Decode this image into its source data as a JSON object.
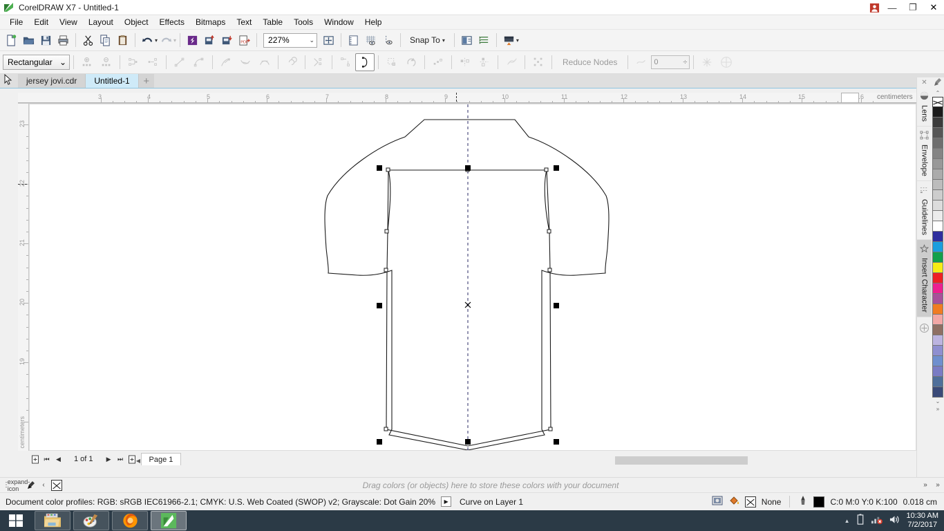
{
  "window": {
    "title": "CorelDRAW X7 - Untitled-1",
    "logo_icon": "coreldraw-logo",
    "user_icon": "user-account-icon",
    "minimize_label": "—",
    "maximize_label": "❐",
    "close_label": "✕"
  },
  "menubar": {
    "items": [
      {
        "label": "File",
        "accel": "F"
      },
      {
        "label": "Edit",
        "accel": "E"
      },
      {
        "label": "View",
        "accel": "V"
      },
      {
        "label": "Layout",
        "accel": "L"
      },
      {
        "label": "Object",
        "accel": "O"
      },
      {
        "label": "Effects",
        "accel": "c"
      },
      {
        "label": "Bitmaps",
        "accel": "B"
      },
      {
        "label": "Text",
        "accel": "x"
      },
      {
        "label": "Table",
        "accel": "T"
      },
      {
        "label": "Tools",
        "accel": "o"
      },
      {
        "label": "Window",
        "accel": "W"
      },
      {
        "label": "Help",
        "accel": "H"
      }
    ]
  },
  "standard_toolbar": {
    "buttons": [
      {
        "name": "new-document-button",
        "title": "New"
      },
      {
        "name": "open-document-button",
        "title": "Open"
      },
      {
        "name": "save-document-button",
        "title": "Save"
      },
      {
        "name": "print-button",
        "title": "Print"
      },
      {
        "name": "cut-button",
        "title": "Cut"
      },
      {
        "name": "copy-button",
        "title": "Copy"
      },
      {
        "name": "paste-button",
        "title": "Paste"
      },
      {
        "name": "undo-button",
        "title": "Undo"
      },
      {
        "name": "redo-button",
        "title": "Redo"
      },
      {
        "name": "corel-connect-button",
        "title": "Search Content"
      },
      {
        "name": "import-button",
        "title": "Import"
      },
      {
        "name": "export-button",
        "title": "Export"
      },
      {
        "name": "publish-pdf-button",
        "title": "Publish to PDF"
      }
    ],
    "zoom_level": "227%",
    "zoom_dropdown_icon": "chevron-down-icon",
    "full_screen_icon": "full-screen-preview-icon",
    "rulers_icon": "show-rulers-icon",
    "grid_icon": "show-grid-icon",
    "guidelines_icon": "show-guidelines-icon",
    "snap_to_label": "Snap To",
    "snap_to_caret": "▾",
    "options_icon": "options-icon",
    "object_manager_icon": "object-manager-icon",
    "application_launcher_icon": "application-launcher-icon"
  },
  "property_bar": {
    "selection_mode": "Rectangular",
    "selection_caret": "⌄",
    "buttons": [
      {
        "name": "add-node-button"
      },
      {
        "name": "delete-node-button"
      },
      {
        "name": "join-two-nodes-button"
      },
      {
        "name": "break-curve-button"
      },
      {
        "name": "convert-to-line-button"
      },
      {
        "name": "convert-to-curve-button"
      },
      {
        "name": "cusp-node-button"
      },
      {
        "name": "smooth-node-button"
      },
      {
        "name": "symmetrical-node-button"
      },
      {
        "name": "reverse-direction-button"
      },
      {
        "name": "extend-curve-to-close-button"
      },
      {
        "name": "extract-subpath-button"
      },
      {
        "name": "close-curve-button"
      },
      {
        "name": "stretch-nodes-button"
      },
      {
        "name": "rotate-nodes-button"
      },
      {
        "name": "align-nodes-button"
      },
      {
        "name": "reflect-nodes-horizontal-button"
      },
      {
        "name": "reflect-nodes-vertical-button"
      },
      {
        "name": "elastic-mode-button"
      },
      {
        "name": "select-all-nodes-button"
      }
    ],
    "reduce_nodes_label": "Reduce Nodes",
    "curve_smoothness_value": "0",
    "bounding-box-icon": "bounding-box-icon",
    "outline-position-icon": "outline-position-icon"
  },
  "document_tabs": {
    "tabs": [
      {
        "label": "jersey jovi.cdr",
        "active": false
      },
      {
        "label": "Untitled-1",
        "active": true
      }
    ],
    "add_label": "+"
  },
  "toolbox": {
    "tools": [
      {
        "name": "pick-tool",
        "active": false
      },
      {
        "name": "shape-tool",
        "active": false
      },
      {
        "name": "crop-tool",
        "active": false
      },
      {
        "name": "zoom-tool",
        "active": false
      },
      {
        "name": "freehand-tool",
        "active": true
      },
      {
        "name": "artistic-media-tool",
        "active": false
      },
      {
        "name": "rectangle-tool",
        "active": false
      },
      {
        "name": "ellipse-tool",
        "active": false
      },
      {
        "name": "polygon-tool",
        "active": false
      },
      {
        "name": "text-tool",
        "active": false
      },
      {
        "name": "parallel-dimension-tool",
        "active": false
      },
      {
        "name": "straight-line-connector-tool",
        "active": false
      },
      {
        "name": "drop-shadow-tool",
        "active": false
      },
      {
        "name": "transparency-tool",
        "active": false
      },
      {
        "name": "color-eyedropper-tool",
        "active": false
      },
      {
        "name": "fill-tool",
        "active": false
      },
      {
        "name": "outline-tool",
        "active": false
      },
      {
        "name": "smart-fill-tool",
        "active": false
      }
    ]
  },
  "rulers": {
    "unit_label": "centimeters",
    "horizontal_ticks": [
      "3",
      "4",
      "5",
      "6",
      "7",
      "8",
      "9",
      "10",
      "11",
      "12",
      "13",
      "14",
      "15",
      "16"
    ],
    "vertical_ticks": [
      "23",
      "22",
      "21",
      "20",
      "19"
    ]
  },
  "drawing": {
    "object_description": "jersey t-shirt outline with selected inner body curve",
    "selected_nodes": 10,
    "center_marker": "rotation-center-marker"
  },
  "page_navigator": {
    "add_page_start_icon": "add-page-icon",
    "first_label": "⏮",
    "prev_label": "◀",
    "page_count": "1 of 1",
    "next_label": "▶",
    "last_label": "⏭",
    "add_page_end_icon": "add-page-icon",
    "page_tab": "Page 1"
  },
  "dockers": {
    "close_label": "✕",
    "items": [
      {
        "label": "Lens",
        "icon": "lens-icon",
        "selected": false
      },
      {
        "label": "Envelope",
        "icon": "envelope-icon",
        "selected": false
      },
      {
        "label": "Guidelines",
        "icon": "guidelines-icon",
        "selected": false
      },
      {
        "label": "Insert Character",
        "icon": "insert-character-icon",
        "selected": true
      }
    ],
    "add_docker_icon": "add-docker-icon"
  },
  "palette": {
    "up_arrow": "⌃",
    "down_arrow": "⌄",
    "more_arrow": "»",
    "eyedropper_icon": "eyedropper-icon",
    "none_swatch": "none",
    "colors": [
      "#1c1c1c",
      "#3c3c3c",
      "#565656",
      "#6e6e6e",
      "#848484",
      "#989898",
      "#ababab",
      "#bcbcbc",
      "#cdcdcd",
      "#dcdcdc",
      "#ececec",
      "#ffffff",
      "#2e2e9e",
      "#1a9ede",
      "#12a04a",
      "#f7ec16",
      "#ee2024",
      "#ec2090",
      "#a7509a",
      "#f07c22",
      "#f2a8a6",
      "#8e6f63",
      "#bcb4e0",
      "#8f8fd0",
      "#6f8fce",
      "#7a7cc4",
      "#4f6f9a",
      "#3a4a78"
    ]
  },
  "drag_bar": {
    "hint": "Drag colors (or objects) here to store these colors with your document",
    "expand_icon": "expand-icon",
    "eyedropper_icon": "eyedropper-icon",
    "left_arrow": "‹",
    "right_arrows": "»"
  },
  "status_bar": {
    "profiles_text": "Document color profiles: RGB: sRGB IEC61966-2.1; CMYK: U.S. Web Coated (SWOP) v2; Grayscale: Dot Gain 20%",
    "profiles_arrow": "▶",
    "object_info": "Curve on Layer 1",
    "snapshot_icon": "snapshot-icon",
    "fill_icon": "fill-bucket-icon",
    "fill_value": "None",
    "outline_icon": "outline-pen-icon",
    "outline_color_hex": "#000000",
    "outline_color_value": "C:0 M:0 Y:0 K:100",
    "outline_width": "0.018 cm"
  },
  "taskbar": {
    "start_icon": "windows-start-icon",
    "apps": [
      {
        "name": "file-explorer",
        "icon": "folder-icon",
        "state": "open"
      },
      {
        "name": "paint",
        "icon": "paint-palette-icon",
        "state": "open"
      },
      {
        "name": "firefox",
        "icon": "firefox-icon",
        "state": "open"
      },
      {
        "name": "coreldraw",
        "icon": "coreldraw-icon",
        "state": "focus"
      }
    ],
    "tray": {
      "show_hidden": "▲",
      "battery_icon": "battery-icon",
      "network_icon": "network-disconnected-icon",
      "volume_icon": "volume-icon"
    },
    "time": "10:30 AM",
    "date": "7/2/2017"
  }
}
